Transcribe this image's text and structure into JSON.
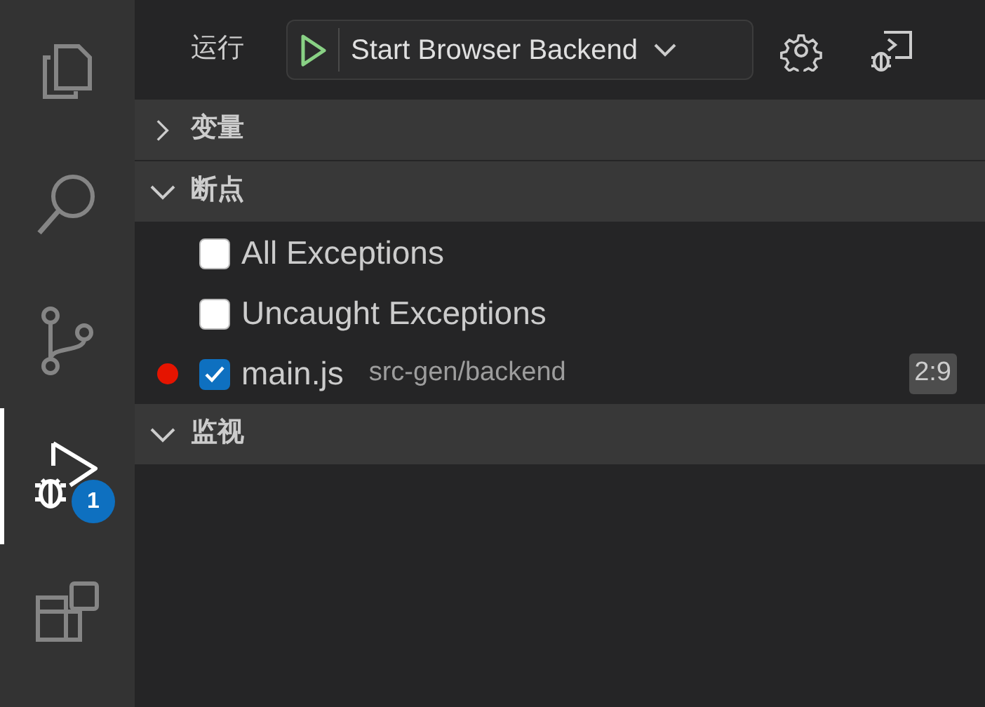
{
  "activity_bar": {
    "items": [
      {
        "kind": "explorer",
        "selected": false
      },
      {
        "kind": "search",
        "selected": false
      },
      {
        "kind": "source-control",
        "selected": false
      },
      {
        "kind": "debug",
        "selected": true,
        "badge": "1"
      },
      {
        "kind": "extensions",
        "selected": false
      }
    ]
  },
  "toolbar": {
    "title": "运行",
    "configuration": "Start Browser Backend"
  },
  "sections": [
    {
      "title": "变量",
      "expanded": false
    },
    {
      "title": "断点",
      "expanded": true,
      "items": [
        {
          "kind": "exception",
          "label": "All Exceptions",
          "checked": false
        },
        {
          "kind": "exception",
          "label": "Uncaught Exceptions",
          "checked": false
        },
        {
          "kind": "file",
          "label": "main.js",
          "path": "src-gen/backend",
          "location": "2:9",
          "checked": true
        }
      ]
    },
    {
      "title": "监视",
      "expanded": true
    }
  ]
}
